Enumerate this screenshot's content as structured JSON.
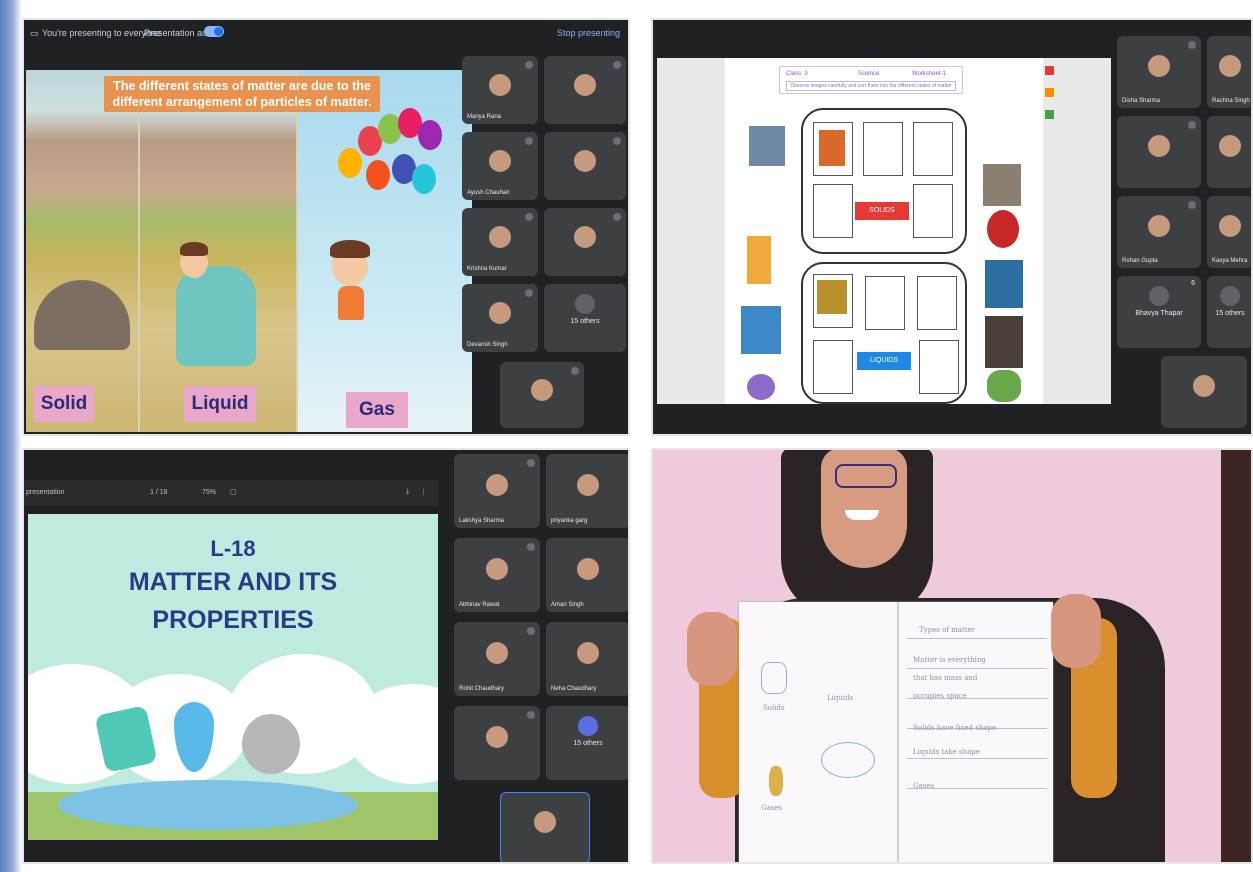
{
  "panel1": {
    "topbar": {
      "presenting_text": "You're presenting to everyone",
      "audio_text": "Presentation audio",
      "stop_text": "Stop presenting"
    },
    "slide": {
      "caption": "The different states of matter are due to the different arrangement of particles of matter.",
      "labels": [
        "Solid",
        "Liquid",
        "Gas"
      ]
    },
    "participants": {
      "names": [
        "Manya Rana",
        "Ayush Chauhan",
        "Krishna Kumar",
        "Devansh Singh"
      ],
      "others_label": "15 others"
    }
  },
  "panel2": {
    "worksheet": {
      "header": [
        "Class: 3",
        "Science",
        "Worksheet-1"
      ],
      "instruction": "Observe images carefully and sort them into the different states of matter",
      "solids_label": "SOLIDS",
      "liquids_label": "LIQUIDS"
    },
    "participants": {
      "names": [
        "Disha Sharma",
        "Rachna Singh",
        "Rohan Gupta",
        "Kavya Mehra"
      ],
      "other_name": "Bhavya Thapar",
      "other_count": "6",
      "others_label": "15 others"
    }
  },
  "panel3": {
    "toolbar": {
      "file_name": "presentation",
      "page_text": "1 / 18",
      "zoom_text": "75%"
    },
    "slide": {
      "lesson": "L-18",
      "title_line1": "MATTER AND ITS",
      "title_line2": "PROPERTIES"
    },
    "participants": {
      "names": [
        "Lakshya Sharma",
        "priyanka garg",
        "Abhinav Rawat",
        "Aman Singh",
        "Rohit Chaudhary",
        "Neha Chaudhary"
      ],
      "others_label": "15 others"
    }
  },
  "panel4": {
    "notebook_left": [
      "Solids",
      "Liquids",
      "Gases"
    ],
    "notebook_right": [
      "Types of matter",
      "Matter is everything",
      "that has mass and",
      "occupies space",
      "Solids have fixed shape",
      "Liquids take shape",
      "Gases"
    ]
  },
  "colors": {
    "meet_bg": "#202124",
    "tile_bg": "#3c4043",
    "accent": "#1a73e8",
    "solids_tag": "#e53935",
    "liquids_tag": "#1e88e5"
  }
}
